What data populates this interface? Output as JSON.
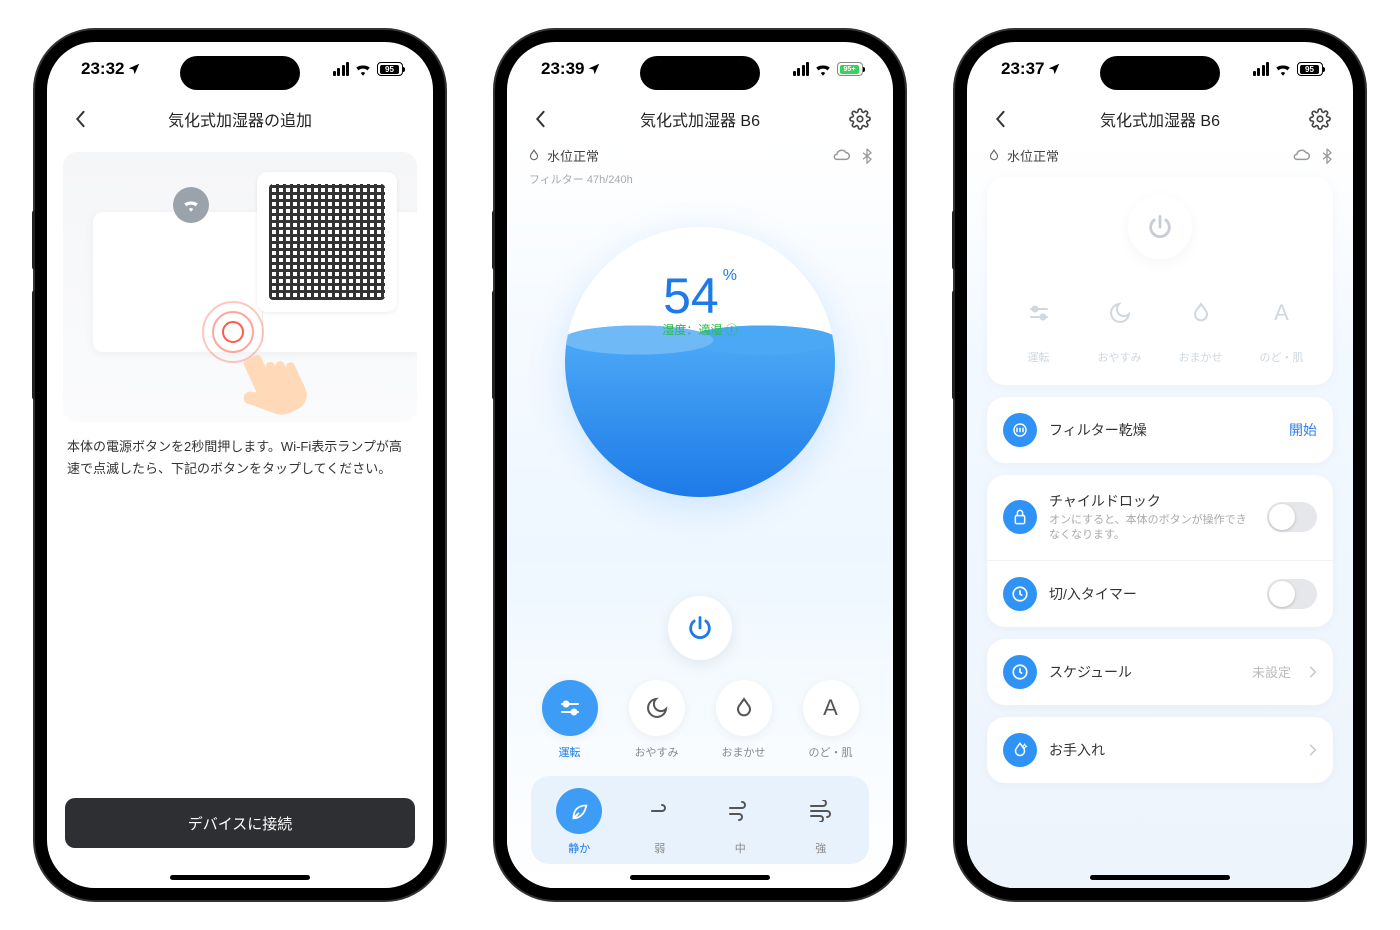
{
  "phones": {
    "p1": {
      "status": {
        "time": "23:32",
        "battery": "95"
      },
      "nav": {
        "title": "気化式加湿器の追加"
      },
      "instruction": "本体の電源ボタンを2秒間押します。Wi-Fi表示ランプが高速で点滅したら、下記のボタンをタップしてください。",
      "connect_button": "デバイスに接続"
    },
    "p2": {
      "status": {
        "time": "23:39",
        "battery": "95+"
      },
      "nav": {
        "title": "気化式加湿器 B6"
      },
      "water_level": "水位正常",
      "filter": "フィルター 47h/240h",
      "humidity": {
        "value": "54",
        "unit": "%",
        "status": "湿度：適湿"
      },
      "modes": [
        {
          "label": "運転",
          "active": true
        },
        {
          "label": "おやすみ",
          "active": false
        },
        {
          "label": "おまかせ",
          "active": false
        },
        {
          "label": "のど・肌",
          "active": false
        }
      ],
      "fan": [
        {
          "label": "静か",
          "active": true
        },
        {
          "label": "弱",
          "active": false
        },
        {
          "label": "中",
          "active": false
        },
        {
          "label": "強",
          "active": false
        }
      ]
    },
    "p3": {
      "status": {
        "time": "23:37",
        "battery": "95"
      },
      "nav": {
        "title": "気化式加湿器 B6"
      },
      "water_level": "水位正常",
      "modes": [
        {
          "label": "運転"
        },
        {
          "label": "おやすみ"
        },
        {
          "label": "おまかせ"
        },
        {
          "label": "のど・肌"
        }
      ],
      "filter_dry": {
        "label": "フィルター乾燥",
        "action": "開始"
      },
      "child_lock": {
        "label": "チャイルドロック",
        "desc": "オンにすると、本体のボタンが操作できなくなります。"
      },
      "timer": {
        "label": "切/入タイマー"
      },
      "schedule": {
        "label": "スケジュール",
        "meta": "未設定"
      },
      "care": {
        "label": "お手入れ"
      }
    }
  }
}
